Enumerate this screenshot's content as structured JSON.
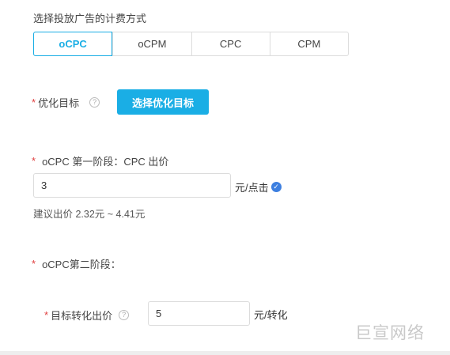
{
  "billing": {
    "title": "选择投放广告的计费方式",
    "options": [
      "oCPC",
      "oCPM",
      "CPC",
      "CPM"
    ],
    "selected": "oCPC"
  },
  "goal": {
    "required_mark": "*",
    "label": "优化目标",
    "help_icon": "?",
    "button_label": "选择优化目标"
  },
  "stage1": {
    "required_mark": "*",
    "label": "oCPC 第一阶段：CPC 出价",
    "input_value": "3",
    "unit": "元/点击",
    "hint": "建议出价 2.32元 ~ 4.41元"
  },
  "stage2": {
    "required_mark": "*",
    "label": "oCPC第二阶段：",
    "target_required_mark": "*",
    "target_label": "目标转化出价",
    "help_icon": "?",
    "input_value": "5",
    "unit": "元/转化"
  },
  "watermark": "巨宣网络",
  "colors": {
    "accent": "#1aaee5",
    "required": "#e04040",
    "verified": "#3d7fe0"
  }
}
